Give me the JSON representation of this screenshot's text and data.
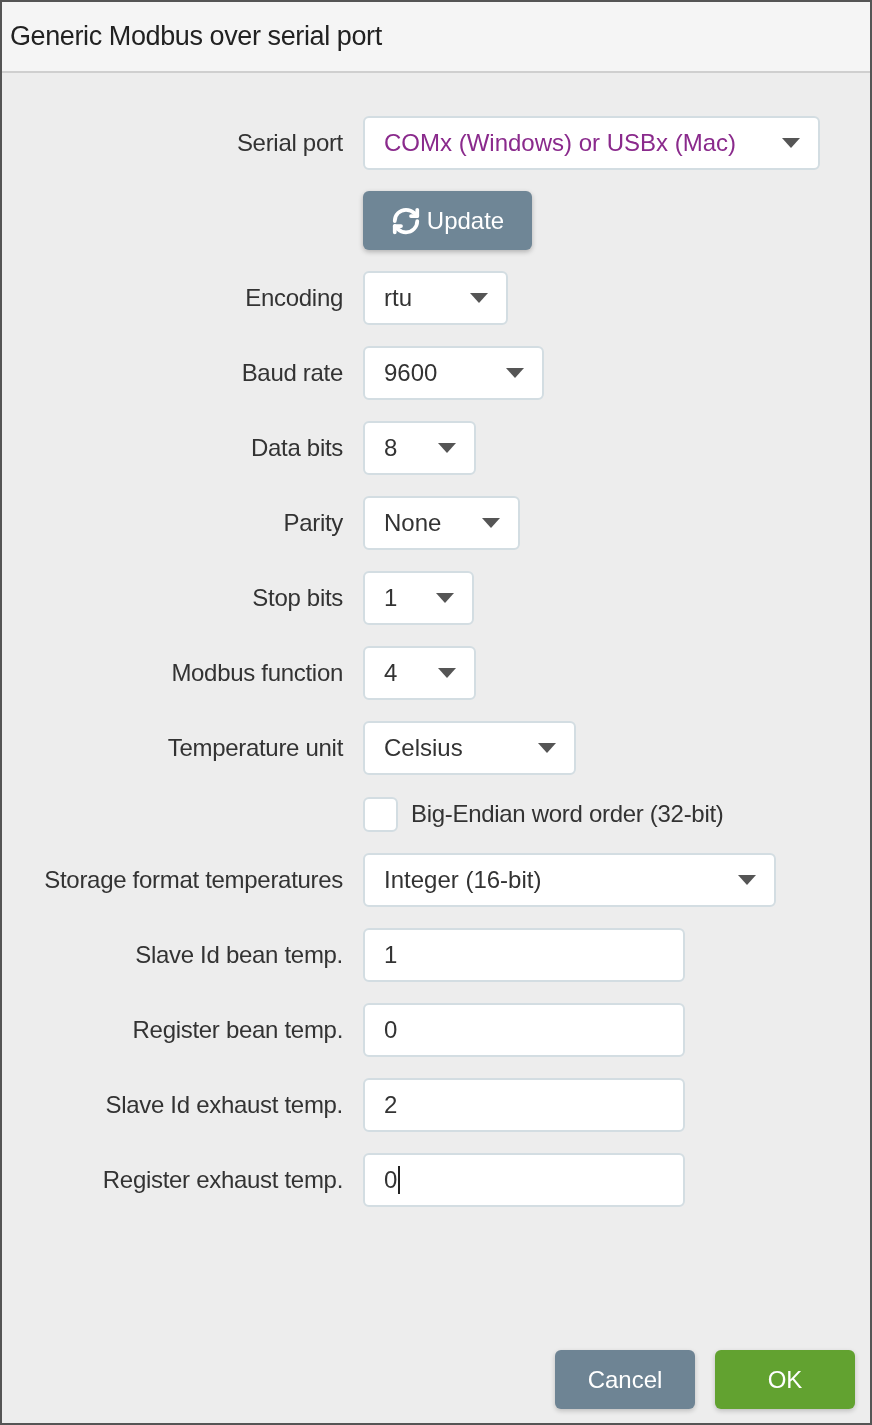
{
  "dialog": {
    "title": "Generic Modbus over serial port"
  },
  "fields": [
    {
      "kind": "select",
      "label": "Serial port",
      "placeholder": "COMx (Windows) or USBx (Mac)"
    },
    {
      "kind": "button",
      "label": "Update"
    },
    {
      "kind": "select",
      "label": "Encoding",
      "value": "rtu"
    },
    {
      "kind": "select",
      "label": "Baud rate",
      "value": "9600"
    },
    {
      "kind": "select",
      "label": "Data bits",
      "value": "8"
    },
    {
      "kind": "select",
      "label": "Parity",
      "value": "None"
    },
    {
      "kind": "select",
      "label": "Stop bits",
      "value": "1"
    },
    {
      "kind": "select",
      "label": "Modbus function",
      "value": "4"
    },
    {
      "kind": "select",
      "label": "Temperature unit",
      "value": "Celsius"
    },
    {
      "kind": "checkbox",
      "label": "Big-Endian word order (32-bit)",
      "checked": false
    },
    {
      "kind": "select",
      "label": "Storage format temperatures",
      "value": "Integer (16-bit)"
    },
    {
      "kind": "input",
      "label": "Slave Id bean temp.",
      "value": "1",
      "focused": false
    },
    {
      "kind": "input",
      "label": "Register bean temp.",
      "value": "0",
      "focused": false
    },
    {
      "kind": "input",
      "label": "Slave Id exhaust temp.",
      "value": "2",
      "focused": false
    },
    {
      "kind": "input",
      "label": "Register exhaust temp.",
      "value": "0",
      "focused": true
    }
  ],
  "buttons": [
    {
      "kind": "secondary",
      "label": "Cancel"
    },
    {
      "kind": "primary",
      "label": "OK"
    }
  ]
}
